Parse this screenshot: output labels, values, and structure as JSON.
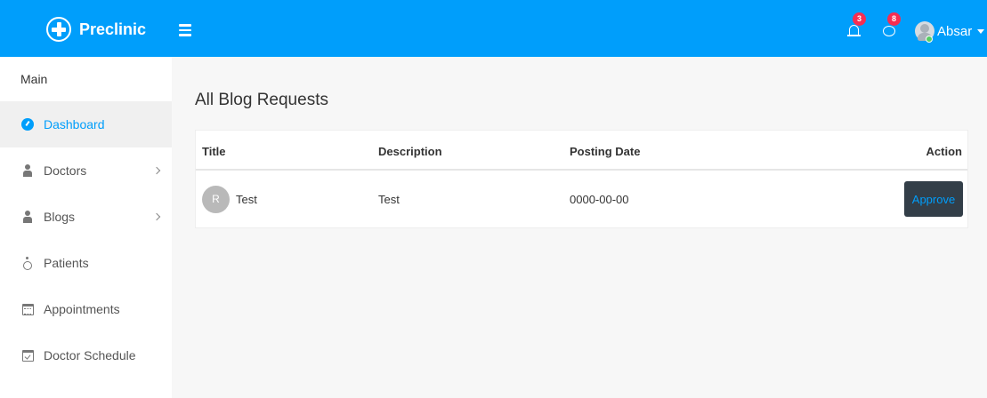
{
  "app": {
    "name": "Preclinic"
  },
  "header": {
    "notifications": {
      "icon": "bell-icon",
      "count": "3"
    },
    "messages": {
      "icon": "chat-bubble-icon",
      "count": "8"
    },
    "user": {
      "name": "Absar",
      "status": "online"
    }
  },
  "sidebar": {
    "title": "Main",
    "items": [
      {
        "label": "Dashboard",
        "icon": "dashboard-icon",
        "active": true
      },
      {
        "label": "Doctors",
        "icon": "user-icon",
        "has_submenu": true
      },
      {
        "label": "Blogs",
        "icon": "user-icon",
        "has_submenu": true
      },
      {
        "label": "Patients",
        "icon": "wheelchair-icon"
      },
      {
        "label": "Appointments",
        "icon": "calendar-icon"
      },
      {
        "label": "Doctor Schedule",
        "icon": "calendar-check-icon"
      }
    ]
  },
  "main": {
    "title": "All Blog Requests",
    "table": {
      "columns": [
        "Title",
        "Description",
        "Posting Date",
        "Action"
      ],
      "rows": [
        {
          "avatar": "R",
          "title": "Test",
          "description": "Test",
          "posting_date": "0000-00-00",
          "action": "Approve"
        }
      ]
    }
  },
  "colors": {
    "header_bg": "#009efb",
    "accent": "#009efb",
    "badge": "#f62d51",
    "approve_bg": "#333e48",
    "online": "#55ce63"
  }
}
